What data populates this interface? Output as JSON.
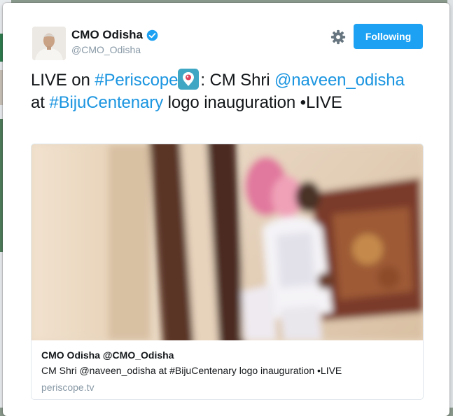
{
  "tweet": {
    "author_name": "CMO Odisha",
    "handle": "@CMO_Odisha",
    "follow_label": "Following",
    "text_parts": {
      "p1": "LIVE on ",
      "hashtag_periscope": "#Periscope",
      "p2": ": CM Shri ",
      "mention": "@naveen_odisha",
      "p3": " at ",
      "hashtag_biju": "#BijuCentenary",
      "p4": " logo inauguration •LIVE"
    }
  },
  "media_card": {
    "title": "CMO Odisha @CMO_Odisha",
    "description": "CM Shri @naveen_odisha at #BijuCentenary logo inauguration •LIVE",
    "domain": "periscope.tv"
  },
  "icons": {
    "verified": "verified-badge-icon",
    "settings": "gear-icon",
    "emoji": "periscope-emoji-icon"
  },
  "colors": {
    "link": "#1b95e0",
    "button": "#1da1f2",
    "muted": "#8899a6",
    "text": "#14171a"
  }
}
